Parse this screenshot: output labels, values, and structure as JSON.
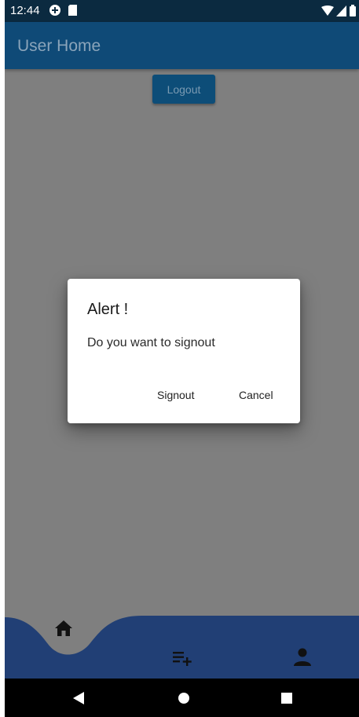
{
  "status_bar": {
    "time": "12:44",
    "left_icons": [
      "data-saver-icon",
      "sd-card-icon"
    ],
    "right_icons": [
      "wifi-icon",
      "cellular-signal-icon",
      "battery-icon"
    ]
  },
  "app_bar": {
    "title": "User Home"
  },
  "main": {
    "logout_label": "Logout"
  },
  "dialog": {
    "title": "Alert !",
    "message": "Do you want to signout",
    "signout_label": "Signout",
    "cancel_label": "Cancel"
  },
  "bottom_nav": {
    "items": [
      {
        "icon": "home-icon",
        "selected": true
      },
      {
        "icon": "playlist-add-icon",
        "selected": false
      },
      {
        "icon": "person-icon",
        "selected": false
      }
    ]
  },
  "system_nav": {
    "buttons": [
      "back-icon",
      "home-circle-icon",
      "recents-icon"
    ]
  },
  "colors": {
    "status_bar": "#0b2a40",
    "app_bar": "#0f4a77",
    "scrim_background": "#7f7f7f",
    "bottom_nav": "#213f75",
    "dialog_background": "#ffffff"
  }
}
